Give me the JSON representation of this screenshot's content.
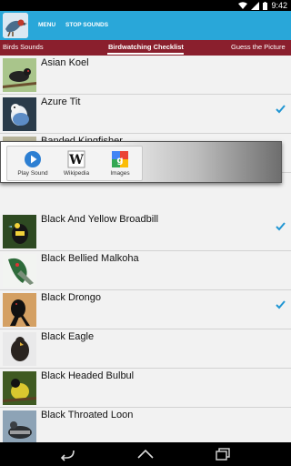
{
  "status": {
    "time": "9:42"
  },
  "actionbar": {
    "menu_label": "MENU",
    "stop_label": "STOP SOUNDS"
  },
  "tabs": [
    {
      "label": "Birds Sounds",
      "active": false
    },
    {
      "label": "Birdwatching Checklist",
      "active": true
    },
    {
      "label": "Guess the Picture",
      "active": false
    }
  ],
  "birds": [
    {
      "name": "Asian Koel",
      "checked": false
    },
    {
      "name": "Azure Tit",
      "checked": true
    },
    {
      "name": "Banded Kingfisher",
      "checked": false
    },
    {
      "name": "Black And Yellow Broadbill",
      "checked": true
    },
    {
      "name": "Black Bellied Malkoha",
      "checked": false
    },
    {
      "name": "Black Drongo",
      "checked": true
    },
    {
      "name": "Black Eagle",
      "checked": false
    },
    {
      "name": "Black Headed Bulbul",
      "checked": false
    },
    {
      "name": "Black Throated Loon",
      "checked": false
    }
  ],
  "popup": {
    "play_label": "Play Sound",
    "wiki_label": "Wikipedia",
    "images_label": "Images"
  },
  "colors": {
    "actionbar": "#29a7d9",
    "tabs": "#8a1f2d",
    "check": "#2196d3"
  }
}
